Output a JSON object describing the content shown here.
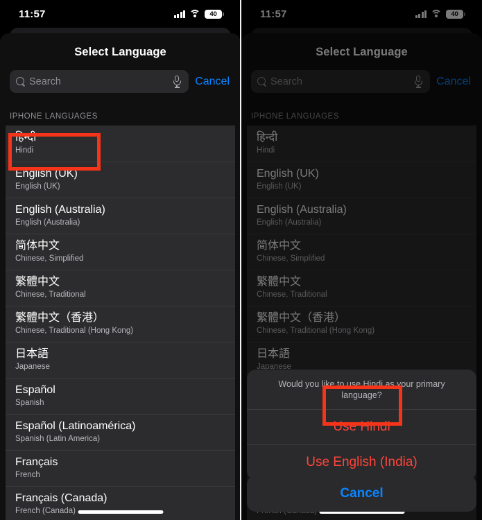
{
  "status_bar": {
    "time": "11:57",
    "cellular_icon": "signal-bars-icon",
    "wifi_icon": "wifi-icon",
    "battery_level": "40"
  },
  "sheet": {
    "title": "Select Language",
    "search": {
      "placeholder": "Search",
      "search_icon": "magnifier-icon",
      "mic_icon": "microphone-icon",
      "cancel_label": "Cancel"
    },
    "section_header": "IPHONE LANGUAGES",
    "languages": [
      {
        "native": "हिन्दी",
        "english": "Hindi"
      },
      {
        "native": "English (UK)",
        "english": "English (UK)"
      },
      {
        "native": "English (Australia)",
        "english": "English (Australia)"
      },
      {
        "native": "简体中文",
        "english": "Chinese, Simplified"
      },
      {
        "native": "繁體中文",
        "english": "Chinese, Traditional"
      },
      {
        "native": "繁體中文（香港）",
        "english": "Chinese, Traditional (Hong Kong)"
      },
      {
        "native": "日本語",
        "english": "Japanese"
      },
      {
        "native": "Español",
        "english": "Spanish"
      },
      {
        "native": "Español (Latinoamérica)",
        "english": "Spanish (Latin America)"
      },
      {
        "native": "Français",
        "english": "French"
      },
      {
        "native": "Français (Canada)",
        "english": "French (Canada)"
      }
    ]
  },
  "action_sheet": {
    "message": "Would you like to use Hindi as your primary language?",
    "primary_option": "Use Hindi",
    "secondary_option": "Use English (India)",
    "cancel_label": "Cancel"
  },
  "annotations": {
    "highlight_color": "#f5341a",
    "box_1_target": "Hindi language row",
    "box_2_target": "Use Hindi button"
  }
}
